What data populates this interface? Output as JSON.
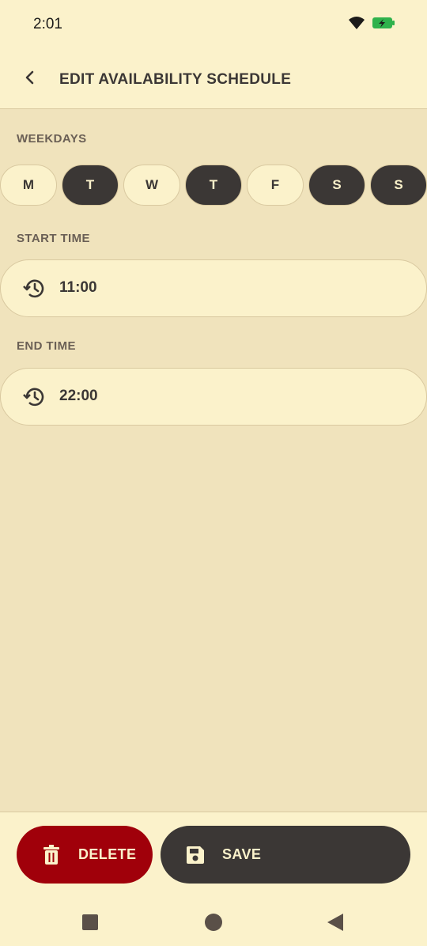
{
  "status_bar": {
    "time": "2:01"
  },
  "app_bar": {
    "title": "EDIT AVAILABILITY SCHEDULE"
  },
  "weekdays": {
    "label": "WEEKDAYS",
    "days": [
      {
        "label": "M",
        "selected": false
      },
      {
        "label": "T",
        "selected": true
      },
      {
        "label": "W",
        "selected": false
      },
      {
        "label": "T",
        "selected": true
      },
      {
        "label": "F",
        "selected": false
      },
      {
        "label": "S",
        "selected": true
      },
      {
        "label": "S",
        "selected": true
      }
    ]
  },
  "start_time": {
    "label": "START TIME",
    "value": "11:00"
  },
  "end_time": {
    "label": "END TIME",
    "value": "22:00"
  },
  "actions": {
    "delete_label": "DELETE",
    "save_label": "SAVE"
  },
  "colors": {
    "background": "#f0e3bc",
    "surface": "#fbf2cb",
    "dark": "#3b3735",
    "danger": "#a0000a",
    "battery": "#2fb24c"
  }
}
